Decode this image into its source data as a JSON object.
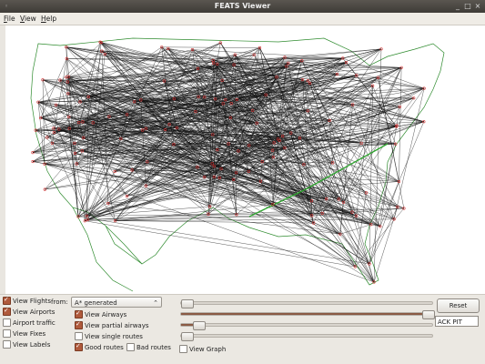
{
  "window": {
    "title": "FEATS Viewer",
    "minimize": "_",
    "maximize": "□",
    "close": "×"
  },
  "menu": {
    "file": "File",
    "view": "View",
    "help": "Help"
  },
  "controls": {
    "view_flights": {
      "label": "View Flights",
      "checked": true
    },
    "view_airports": {
      "label": "View Airports",
      "checked": true
    },
    "airport_traffic": {
      "label": "Airport traffic",
      "checked": false
    },
    "view_fixes": {
      "label": "View Fixes",
      "checked": false
    },
    "view_labels": {
      "label": "View Labels",
      "checked": false
    },
    "from_label": "from:",
    "from_select": "A* generated",
    "view_airways": {
      "label": "View Airways",
      "checked": true
    },
    "view_partial_airways": {
      "label": "View partial airways",
      "checked": true
    },
    "view_single_routes": {
      "label": "View single routes",
      "checked": false
    },
    "good_routes": {
      "label": "Good routes",
      "checked": true
    },
    "bad_routes": {
      "label": "Bad routes",
      "checked": false
    },
    "view_graph": {
      "label": "View Graph",
      "checked": false
    },
    "reset": "Reset",
    "airport_field": "ACK PIT",
    "slider_levels": [
      0.01,
      0.99,
      0.07,
      0.01
    ]
  },
  "colors": {
    "route_lines": "#111111",
    "borders": "#2e8b2e",
    "airports": "#d23030",
    "highlight_route": "#2fa52f"
  }
}
